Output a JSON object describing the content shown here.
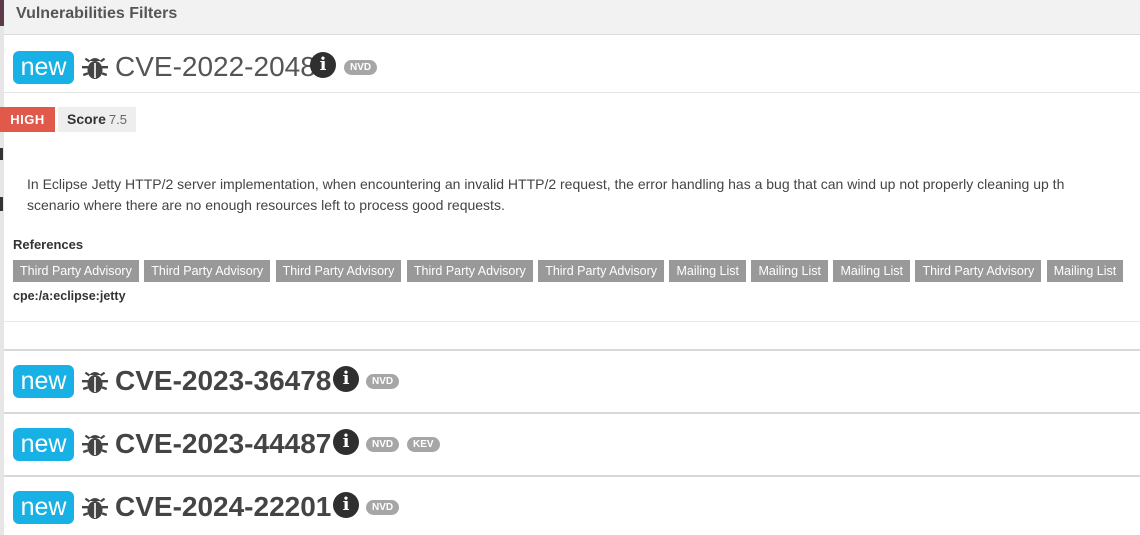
{
  "header": {
    "title": "Vulnerabilities Filters"
  },
  "vulnerabilities": [
    {
      "badge": "new",
      "id": "CVE-2022-2048",
      "sources": [
        "NVD"
      ],
      "severity": "HIGH",
      "score_label": "Score",
      "score_value": "7.5",
      "description_lines": [
        "In Eclipse Jetty HTTP/2 server implementation, when encountering an invalid HTTP/2 request, the error handling has a bug that can wind up not properly cleaning up th",
        "scenario where there are no enough resources left to process good requests."
      ],
      "references_title": "References",
      "references": [
        "Third Party Advisory",
        "Third Party Advisory",
        "Third Party Advisory",
        "Third Party Advisory",
        "Third Party Advisory",
        "Mailing List",
        "Mailing List",
        "Mailing List",
        "Third Party Advisory",
        "Mailing List"
      ],
      "cpe": "cpe:/a:eclipse:jetty"
    },
    {
      "badge": "new",
      "id": "CVE-2023-36478",
      "sources": [
        "NVD"
      ]
    },
    {
      "badge": "new",
      "id": "CVE-2023-44487",
      "sources": [
        "NVD",
        "KEV"
      ]
    },
    {
      "badge": "new",
      "id": "CVE-2024-22201",
      "sources": [
        "NVD"
      ]
    }
  ],
  "icons": {
    "bug": "bug-icon",
    "info": "info-icon"
  },
  "colors": {
    "new_badge": "#17b1e6",
    "severity_high": "#e0594a",
    "reference_tag": "#999999",
    "source_badge": "#a6a6a6"
  }
}
